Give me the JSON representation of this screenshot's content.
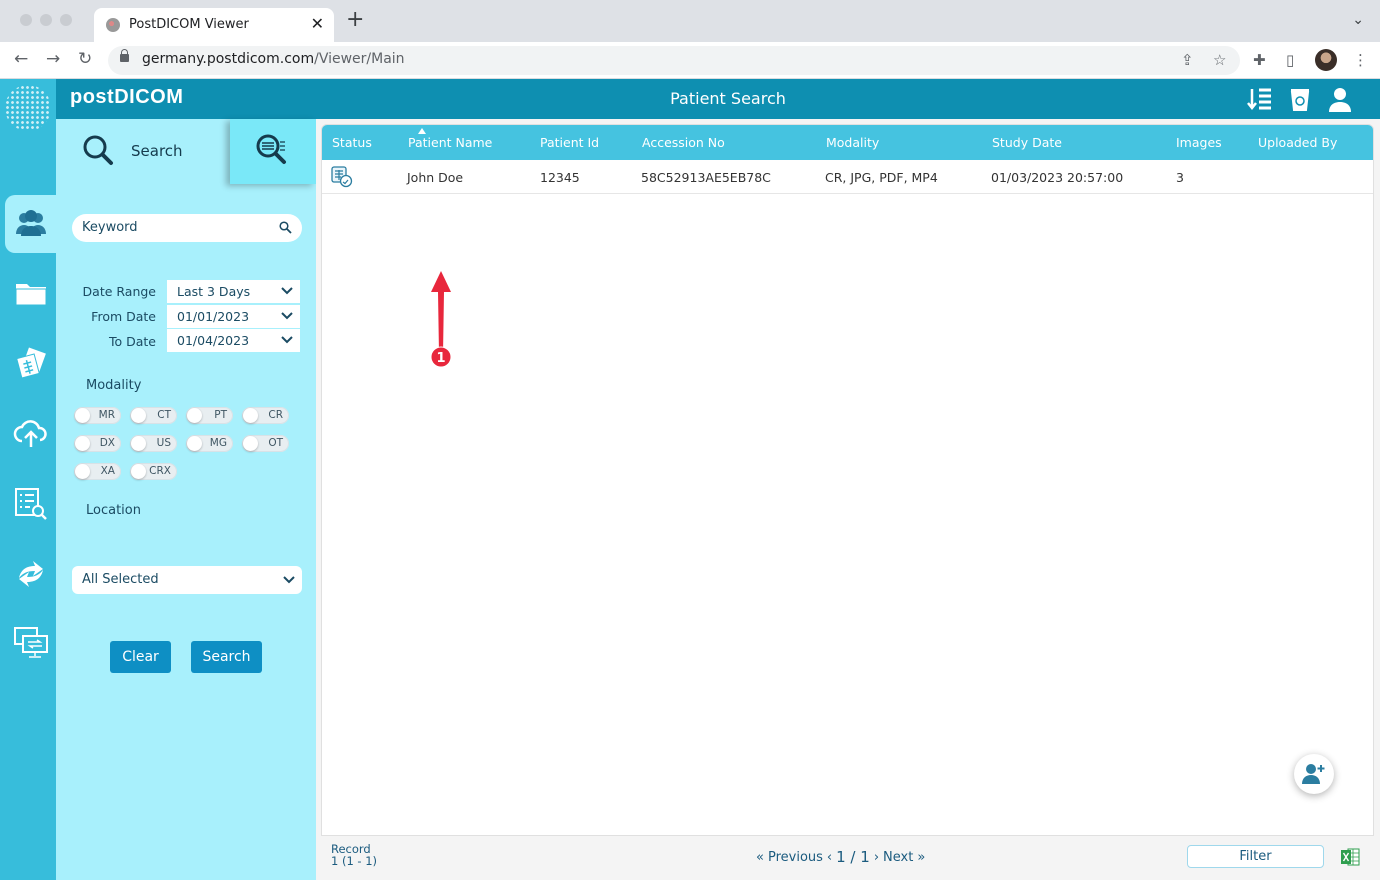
{
  "browser": {
    "tab_title": "PostDICOM Viewer",
    "url_domain": "germany.postdicom.com",
    "url_path": "/Viewer/Main"
  },
  "app": {
    "brand": "postDICOM",
    "page_title": "Patient Search",
    "nav_items": [
      "patients",
      "folders",
      "studies",
      "upload",
      "worklist",
      "transfer",
      "remote"
    ]
  },
  "search_panel": {
    "tab_search_label": "Search",
    "keyword_placeholder": "Keyword",
    "date_range_label": "Date Range",
    "date_range_value": "Last 3 Days",
    "from_date_label": "From Date",
    "from_date_value": "01/01/2023",
    "to_date_label": "To Date",
    "to_date_value": "01/04/2023",
    "modality_label": "Modality",
    "modalities": [
      "MR",
      "CT",
      "PT",
      "CR",
      "DX",
      "US",
      "MG",
      "OT",
      "XA",
      "CRX"
    ],
    "location_label": "Location",
    "location_value": "All Selected",
    "clear_label": "Clear",
    "search_label": "Search"
  },
  "table": {
    "columns": [
      "Status",
      "Patient Name",
      "Patient Id",
      "Accession No",
      "Modality",
      "Study Date",
      "Images",
      "Uploaded By"
    ],
    "sorted_column": "Patient Name",
    "rows": [
      {
        "patient_name": "John Doe",
        "patient_id": "12345",
        "accession_no": "58C52913AE5EB78C",
        "modality": "CR, JPG, PDF, MP4",
        "study_date": "01/03/2023 20:57:00",
        "images": "3",
        "uploaded_by": ""
      }
    ]
  },
  "annotation": {
    "marker": "1"
  },
  "footer": {
    "record_label": "Record",
    "record_value": "1 (1 - 1)",
    "previous_label": "Previous",
    "page_indicator": "1 / 1",
    "next_label": "Next",
    "filter_label": "Filter"
  },
  "colors": {
    "header": "#0e8fb1",
    "sidebar": "#37bddb",
    "panel": "#a8f0fc",
    "table_header": "#45c3e0",
    "button": "#0e8fc4",
    "annotation": "#e8273c"
  }
}
